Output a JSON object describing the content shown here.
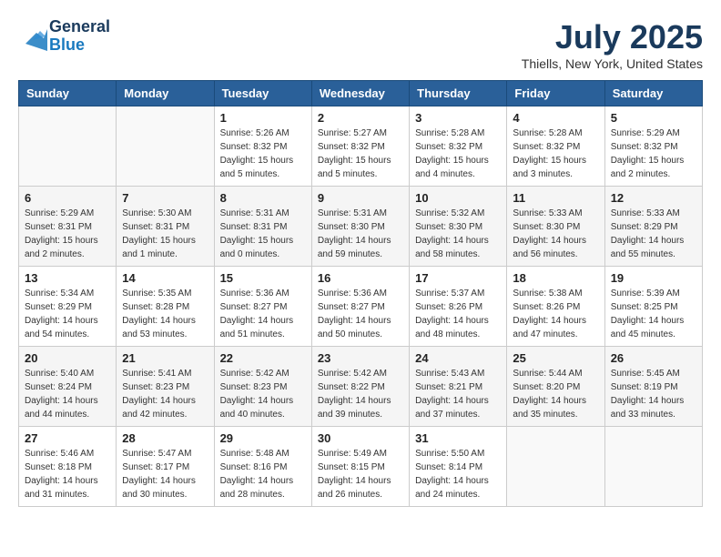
{
  "header": {
    "logo_general": "General",
    "logo_blue": "Blue",
    "main_title": "July 2025",
    "subtitle": "Thiells, New York, United States"
  },
  "calendar": {
    "days_of_week": [
      "Sunday",
      "Monday",
      "Tuesday",
      "Wednesday",
      "Thursday",
      "Friday",
      "Saturday"
    ],
    "weeks": [
      [
        {
          "day": "",
          "info": ""
        },
        {
          "day": "",
          "info": ""
        },
        {
          "day": "1",
          "info": "Sunrise: 5:26 AM\nSunset: 8:32 PM\nDaylight: 15 hours\nand 5 minutes."
        },
        {
          "day": "2",
          "info": "Sunrise: 5:27 AM\nSunset: 8:32 PM\nDaylight: 15 hours\nand 5 minutes."
        },
        {
          "day": "3",
          "info": "Sunrise: 5:28 AM\nSunset: 8:32 PM\nDaylight: 15 hours\nand 4 minutes."
        },
        {
          "day": "4",
          "info": "Sunrise: 5:28 AM\nSunset: 8:32 PM\nDaylight: 15 hours\nand 3 minutes."
        },
        {
          "day": "5",
          "info": "Sunrise: 5:29 AM\nSunset: 8:32 PM\nDaylight: 15 hours\nand 2 minutes."
        }
      ],
      [
        {
          "day": "6",
          "info": "Sunrise: 5:29 AM\nSunset: 8:31 PM\nDaylight: 15 hours\nand 2 minutes."
        },
        {
          "day": "7",
          "info": "Sunrise: 5:30 AM\nSunset: 8:31 PM\nDaylight: 15 hours\nand 1 minute."
        },
        {
          "day": "8",
          "info": "Sunrise: 5:31 AM\nSunset: 8:31 PM\nDaylight: 15 hours\nand 0 minutes."
        },
        {
          "day": "9",
          "info": "Sunrise: 5:31 AM\nSunset: 8:30 PM\nDaylight: 14 hours\nand 59 minutes."
        },
        {
          "day": "10",
          "info": "Sunrise: 5:32 AM\nSunset: 8:30 PM\nDaylight: 14 hours\nand 58 minutes."
        },
        {
          "day": "11",
          "info": "Sunrise: 5:33 AM\nSunset: 8:30 PM\nDaylight: 14 hours\nand 56 minutes."
        },
        {
          "day": "12",
          "info": "Sunrise: 5:33 AM\nSunset: 8:29 PM\nDaylight: 14 hours\nand 55 minutes."
        }
      ],
      [
        {
          "day": "13",
          "info": "Sunrise: 5:34 AM\nSunset: 8:29 PM\nDaylight: 14 hours\nand 54 minutes."
        },
        {
          "day": "14",
          "info": "Sunrise: 5:35 AM\nSunset: 8:28 PM\nDaylight: 14 hours\nand 53 minutes."
        },
        {
          "day": "15",
          "info": "Sunrise: 5:36 AM\nSunset: 8:27 PM\nDaylight: 14 hours\nand 51 minutes."
        },
        {
          "day": "16",
          "info": "Sunrise: 5:36 AM\nSunset: 8:27 PM\nDaylight: 14 hours\nand 50 minutes."
        },
        {
          "day": "17",
          "info": "Sunrise: 5:37 AM\nSunset: 8:26 PM\nDaylight: 14 hours\nand 48 minutes."
        },
        {
          "day": "18",
          "info": "Sunrise: 5:38 AM\nSunset: 8:26 PM\nDaylight: 14 hours\nand 47 minutes."
        },
        {
          "day": "19",
          "info": "Sunrise: 5:39 AM\nSunset: 8:25 PM\nDaylight: 14 hours\nand 45 minutes."
        }
      ],
      [
        {
          "day": "20",
          "info": "Sunrise: 5:40 AM\nSunset: 8:24 PM\nDaylight: 14 hours\nand 44 minutes."
        },
        {
          "day": "21",
          "info": "Sunrise: 5:41 AM\nSunset: 8:23 PM\nDaylight: 14 hours\nand 42 minutes."
        },
        {
          "day": "22",
          "info": "Sunrise: 5:42 AM\nSunset: 8:23 PM\nDaylight: 14 hours\nand 40 minutes."
        },
        {
          "day": "23",
          "info": "Sunrise: 5:42 AM\nSunset: 8:22 PM\nDaylight: 14 hours\nand 39 minutes."
        },
        {
          "day": "24",
          "info": "Sunrise: 5:43 AM\nSunset: 8:21 PM\nDaylight: 14 hours\nand 37 minutes."
        },
        {
          "day": "25",
          "info": "Sunrise: 5:44 AM\nSunset: 8:20 PM\nDaylight: 14 hours\nand 35 minutes."
        },
        {
          "day": "26",
          "info": "Sunrise: 5:45 AM\nSunset: 8:19 PM\nDaylight: 14 hours\nand 33 minutes."
        }
      ],
      [
        {
          "day": "27",
          "info": "Sunrise: 5:46 AM\nSunset: 8:18 PM\nDaylight: 14 hours\nand 31 minutes."
        },
        {
          "day": "28",
          "info": "Sunrise: 5:47 AM\nSunset: 8:17 PM\nDaylight: 14 hours\nand 30 minutes."
        },
        {
          "day": "29",
          "info": "Sunrise: 5:48 AM\nSunset: 8:16 PM\nDaylight: 14 hours\nand 28 minutes."
        },
        {
          "day": "30",
          "info": "Sunrise: 5:49 AM\nSunset: 8:15 PM\nDaylight: 14 hours\nand 26 minutes."
        },
        {
          "day": "31",
          "info": "Sunrise: 5:50 AM\nSunset: 8:14 PM\nDaylight: 14 hours\nand 24 minutes."
        },
        {
          "day": "",
          "info": ""
        },
        {
          "day": "",
          "info": ""
        }
      ]
    ]
  }
}
